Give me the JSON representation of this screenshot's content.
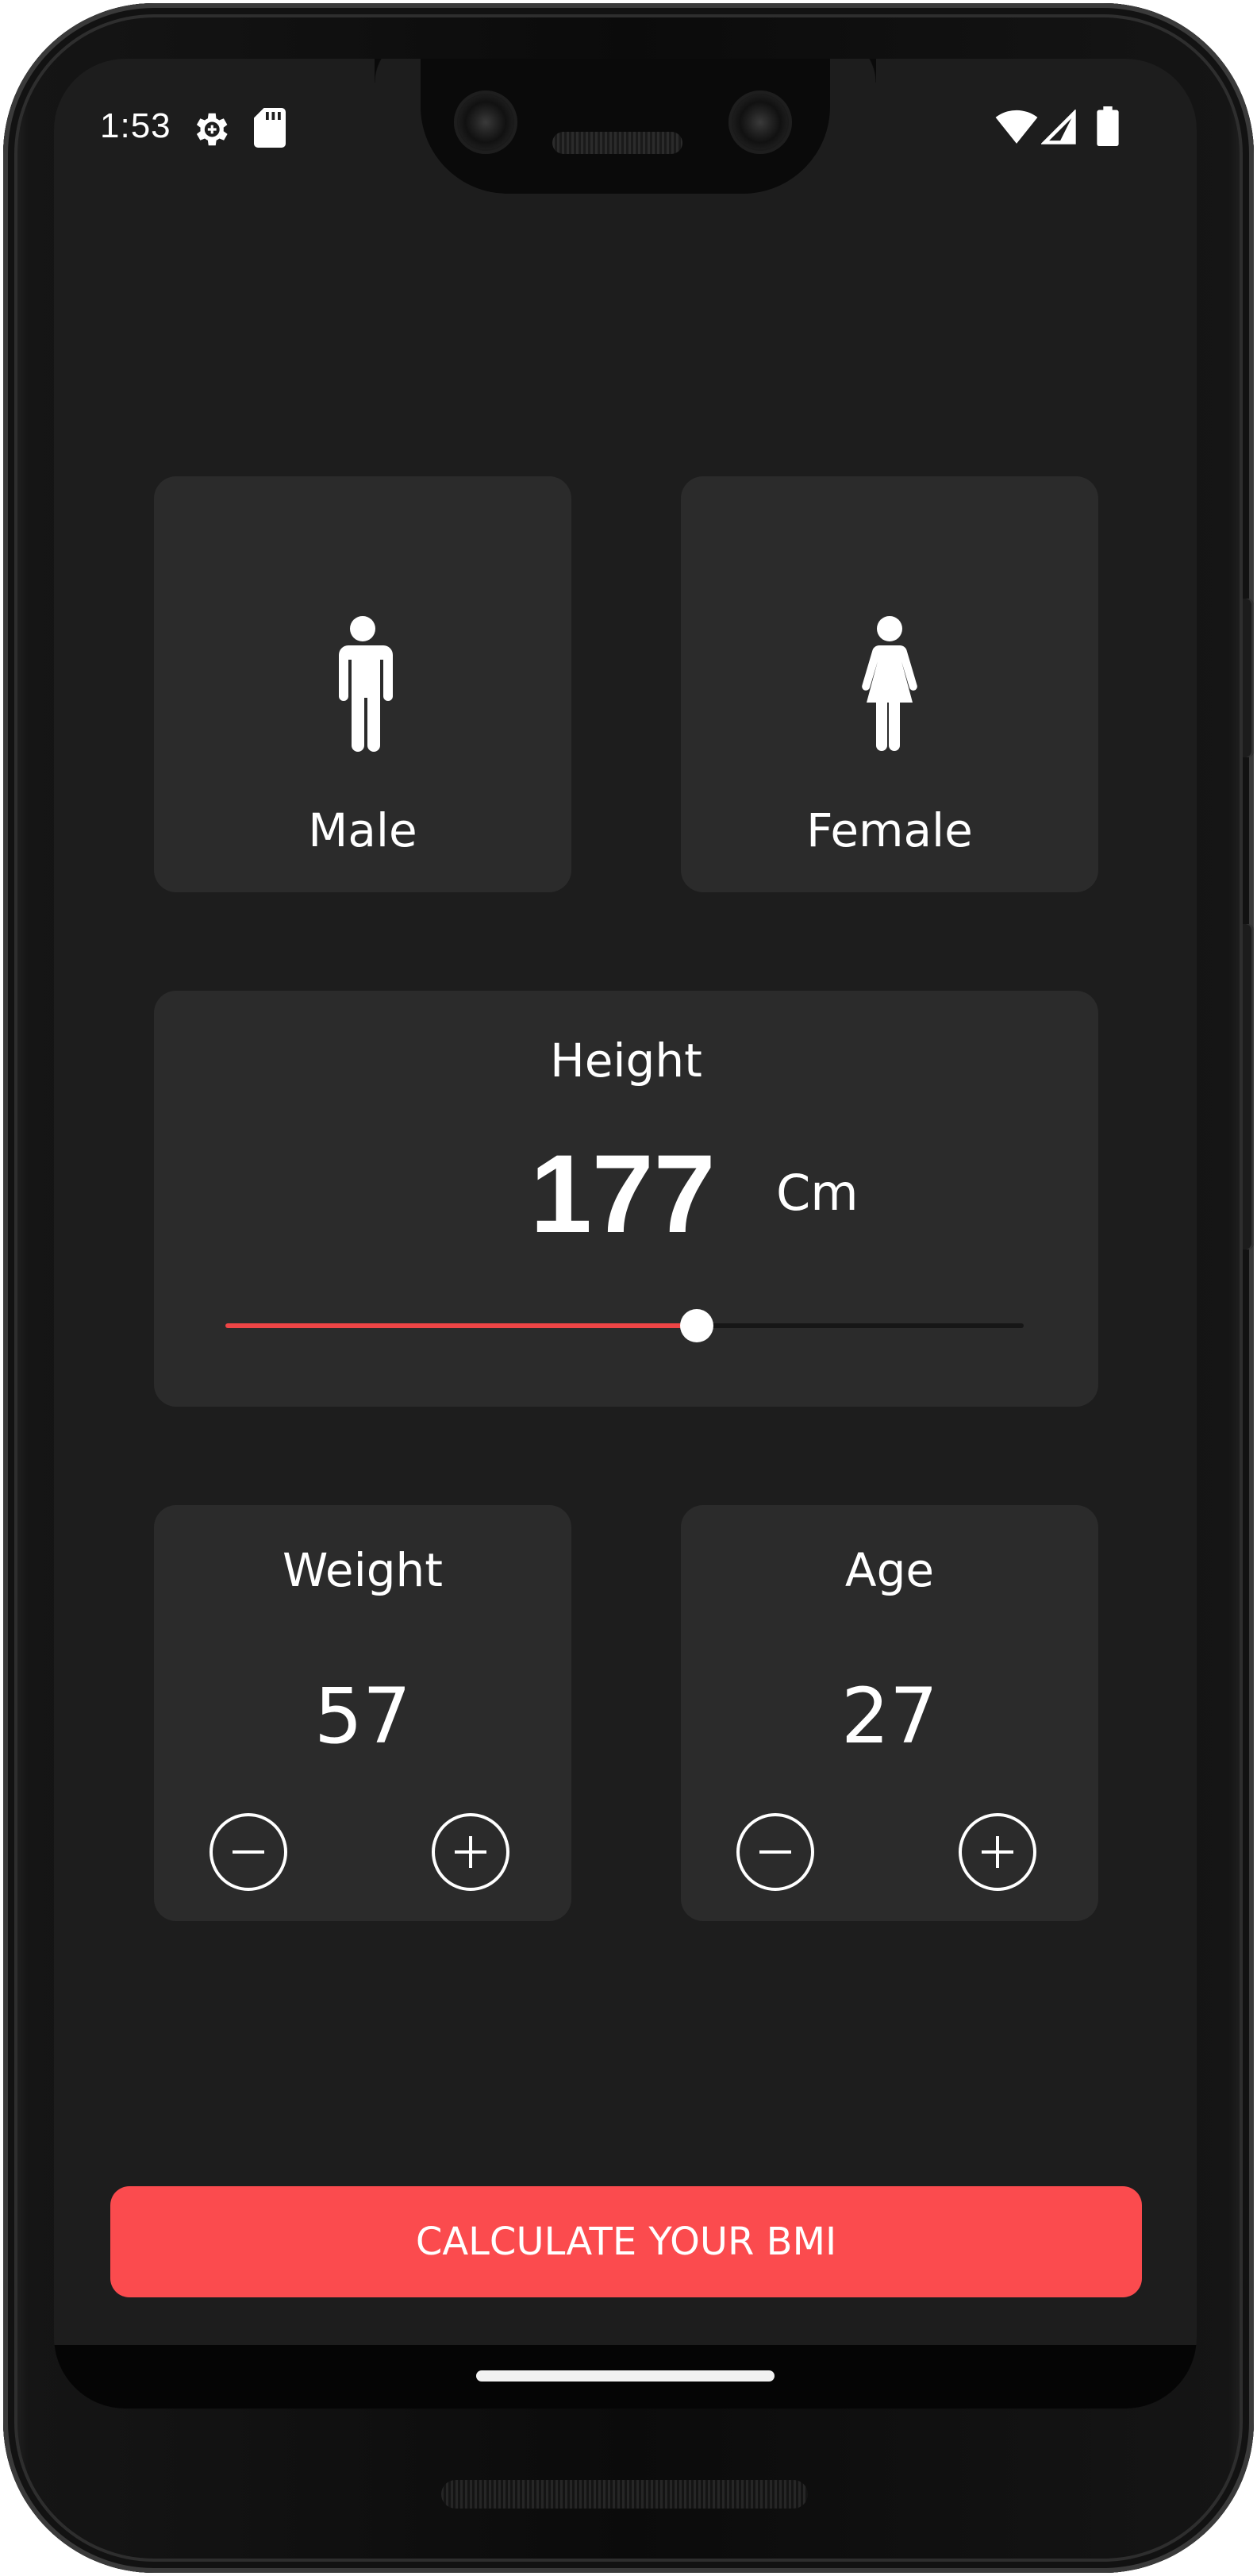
{
  "status_bar": {
    "time": "1:53",
    "left_icons": [
      "settings-icon",
      "sd-card-icon"
    ],
    "right_icons": [
      "wifi-icon",
      "cell-signal-icon",
      "battery-icon"
    ]
  },
  "gender": {
    "male_label": "Male",
    "female_label": "Female"
  },
  "height": {
    "label": "Height",
    "value": "177",
    "unit": "Cm",
    "slider_fraction": 0.59
  },
  "weight": {
    "label": "Weight",
    "value": "57"
  },
  "age": {
    "label": "Age",
    "value": "27"
  },
  "action": {
    "calculate_label": "CALCULATE YOUR BMI"
  },
  "colors": {
    "background": "#1d1d1d",
    "card": "#2b2b2b",
    "accent": "#fb4b4e",
    "slider_active": "#ee4546",
    "text": "#ffffff"
  }
}
